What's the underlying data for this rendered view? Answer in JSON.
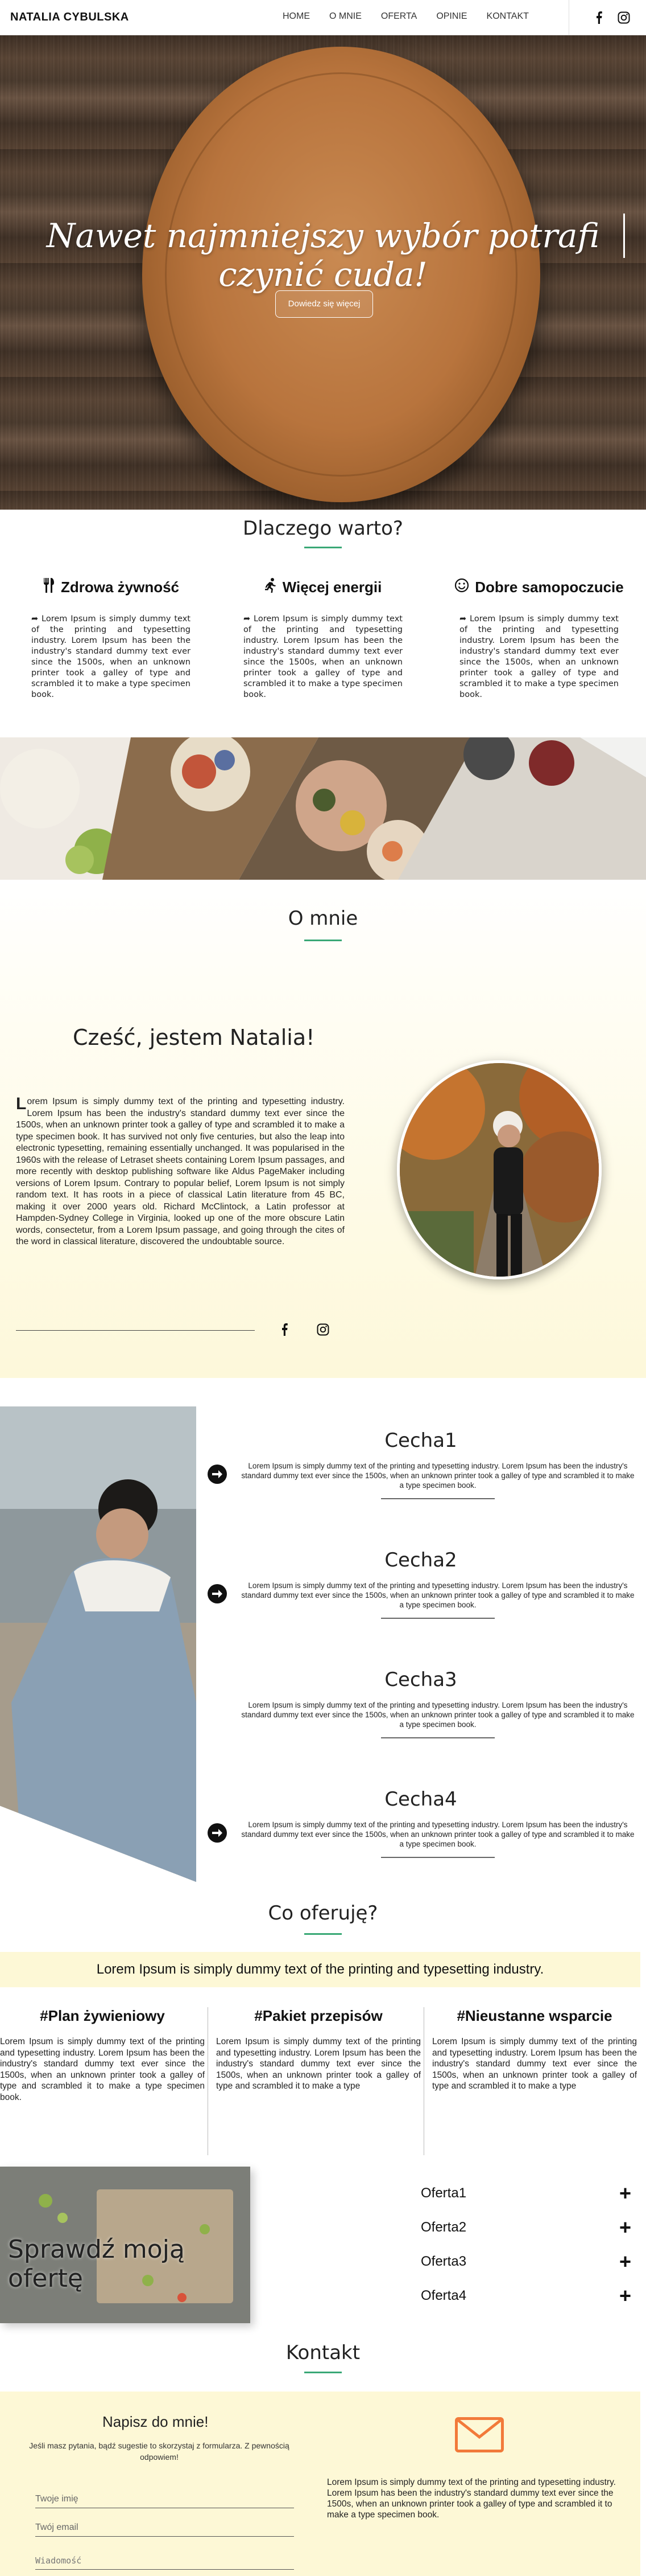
{
  "nav": {
    "brand": "NATALIA CYBULSKA",
    "items": [
      "HOME",
      "O MNIE",
      "OFERTA",
      "OPINIE",
      "KONTAKT"
    ],
    "icons": [
      "facebook-icon",
      "instagram-icon"
    ]
  },
  "hero": {
    "title": "Nawet najmniejszy wybór potrafi czynić cuda!",
    "button": "Dowiedz się więcej"
  },
  "why": {
    "title": "Dlaczego warto?",
    "columns": [
      {
        "icon": "cutlery-icon",
        "heading": "Zdrowa żywność",
        "text": "Lorem Ipsum is simply dummy text of the printing and typesetting industry. Lorem Ipsum has been the industry's standard dummy text ever since the 1500s, when an unknown printer took a galley of type and scrambled it to make a type specimen book."
      },
      {
        "icon": "running-icon",
        "heading": "Więcej energii",
        "text": "Lorem Ipsum is simply dummy text of the printing and typesetting industry. Lorem Ipsum has been the industry's standard dummy text ever since the 1500s, when an unknown printer took a galley of type and scrambled it to make a type specimen book."
      },
      {
        "icon": "smile-icon",
        "heading": "Dobre samopoczucie",
        "text": "Lorem Ipsum is simply dummy text of the printing and typesetting industry. Lorem Ipsum has been the industry's standard dummy text ever since the 1500s, when an unknown printer took a galley of type and scrambled it to make a type specimen book."
      }
    ]
  },
  "about": {
    "title": "O mnie",
    "greeting": "Cześć, jestem Natalia!",
    "first_letter": "L",
    "text": "orem Ipsum is simply dummy text of the printing and typesetting industry. Lorem Ipsum has been the industry's standard dummy text ever since the 1500s, when an unknown printer took a galley of type and scrambled it to make a type specimen book. It has survived not only five centuries, but also the leap into electronic typesetting, remaining essentially unchanged. It was popularised in the 1960s with the release of Letraset sheets containing Lorem Ipsum passages, and more recently with desktop publishing software like Aldus PageMaker including versions of Lorem Ipsum. Contrary to popular belief, Lorem Ipsum is not simply random text. It has roots in a piece of classical Latin literature from 45 BC, making it over 2000 years old. Richard McClintock, a Latin professor at Hampden-Sydney College in Virginia, looked up one of the more obscure Latin words, consectetur, from a Lorem Ipsum passage, and going through the cites of the word in classical literature, discovered the undoubtable source."
  },
  "features": [
    {
      "title": "Cecha1",
      "text": "Lorem Ipsum is simply dummy text of the printing and typesetting industry. Lorem Ipsum has been the industry's standard dummy text ever since the 1500s, when an unknown printer took a galley of type and scrambled it to make a type specimen book."
    },
    {
      "title": "Cecha2",
      "text": "Lorem Ipsum is simply dummy text of the printing and typesetting industry. Lorem Ipsum has been the industry's standard dummy text ever since the 1500s, when an unknown printer took a galley of type and scrambled it to make a type specimen book."
    },
    {
      "title": "Cecha3",
      "text": "Lorem Ipsum is simply dummy text of the printing and typesetting industry. Lorem Ipsum has been the industry's standard dummy text ever since the 1500s, when an unknown printer took a galley of type and scrambled it to make a type specimen book."
    },
    {
      "title": "Cecha4",
      "text": "Lorem Ipsum is simply dummy text of the printing and typesetting industry. Lorem Ipsum has been the industry's standard dummy text ever since the 1500s, when an unknown printer took a galley of type and scrambled it to make a type specimen book."
    }
  ],
  "offer": {
    "title": "Co oferuję?",
    "band": "Lorem Ipsum is simply dummy text of the printing and typesetting industry.",
    "columns": [
      {
        "heading": "#Plan żywieniowy",
        "text": "Lorem Ipsum is simply dummy text of the printing and typesetting industry. Lorem Ipsum has been the industry's standard dummy text ever since the 1500s, when an unknown printer took a galley of type and scrambled it to make a type specimen book."
      },
      {
        "heading": "#Pakiet przepisów",
        "text": "Lorem Ipsum is simply dummy text of the printing and typesetting industry. Lorem Ipsum has been the industry's standard dummy text ever since the 1500s, when an unknown printer took a galley of type and scrambled it to make a type"
      },
      {
        "heading": "#Nieustanne wsparcie",
        "text": "Lorem Ipsum is simply dummy text of the printing and typesetting industry. Lorem Ipsum has been the industry's standard dummy text ever since the 1500s, when an unknown printer took a galley of type and scrambled it to make a type"
      }
    ],
    "check_label": "Sprawdź moją ofertę",
    "accordion": [
      "Oferta1",
      "Oferta2",
      "Oferta3",
      "Oferta4"
    ]
  },
  "contact": {
    "title": "Kontakt",
    "write": "Napisz do mnie!",
    "sub": "Jeśli masz pytania, bądź sugestie to skorzystaj z formularza. Z pewnością odpowiem!",
    "name_placeholder": "Twoje imię",
    "email_placeholder": "Twój email",
    "message_placeholder": "Wiadomość",
    "text": "Lorem Ipsum is simply dummy text of the printing and typesetting industry. Lorem Ipsum has been the industry's standard dummy text ever since the 1500s, when an unknown printer took a galley of type and scrambled it to make a type specimen book."
  },
  "colors": {
    "accent": "#3aa876",
    "band": "#fdf8d6",
    "mail": "#f27a3a"
  }
}
